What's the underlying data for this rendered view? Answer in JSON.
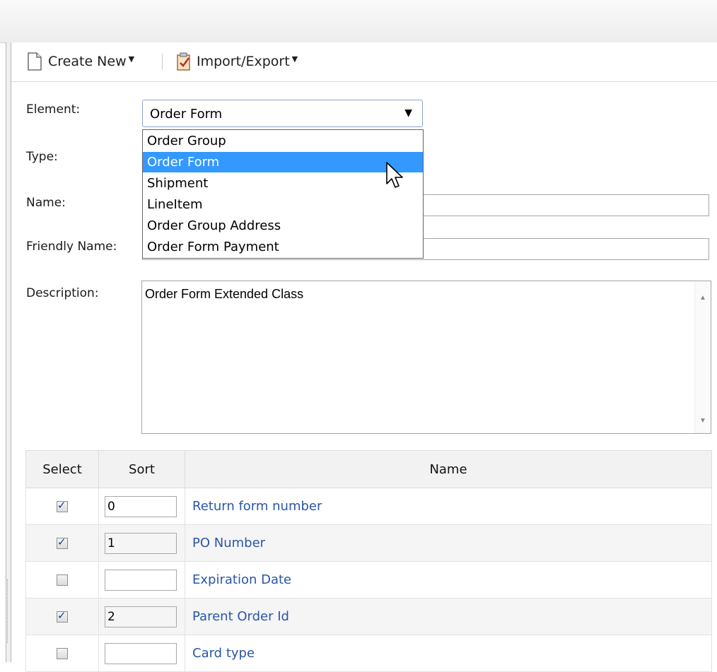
{
  "toolbar": {
    "create_new_label": "Create New",
    "import_export_label": "Import/Export"
  },
  "form": {
    "element_label": "Element:",
    "element_value": "Order Form",
    "type_label": "Type:",
    "name_label": "Name:",
    "friendly_name_label": "Friendly Name:",
    "description_label": "Description:",
    "description_value": "Order Form Extended Class"
  },
  "dropdown": {
    "options": [
      "Order Group",
      "Order Form",
      "Shipment",
      "LineItem",
      "Order Group Address",
      "Order Form Payment"
    ],
    "selected_index": 1
  },
  "table": {
    "headers": [
      "Select",
      "Sort",
      "Name"
    ],
    "rows": [
      {
        "checked": true,
        "sort": "0",
        "name": "Return form number"
      },
      {
        "checked": true,
        "sort": "1",
        "name": "PO Number"
      },
      {
        "checked": false,
        "sort": "",
        "name": "Expiration Date"
      },
      {
        "checked": true,
        "sort": "2",
        "name": "Parent Order Id"
      },
      {
        "checked": false,
        "sort": "",
        "name": "Card type"
      }
    ]
  }
}
